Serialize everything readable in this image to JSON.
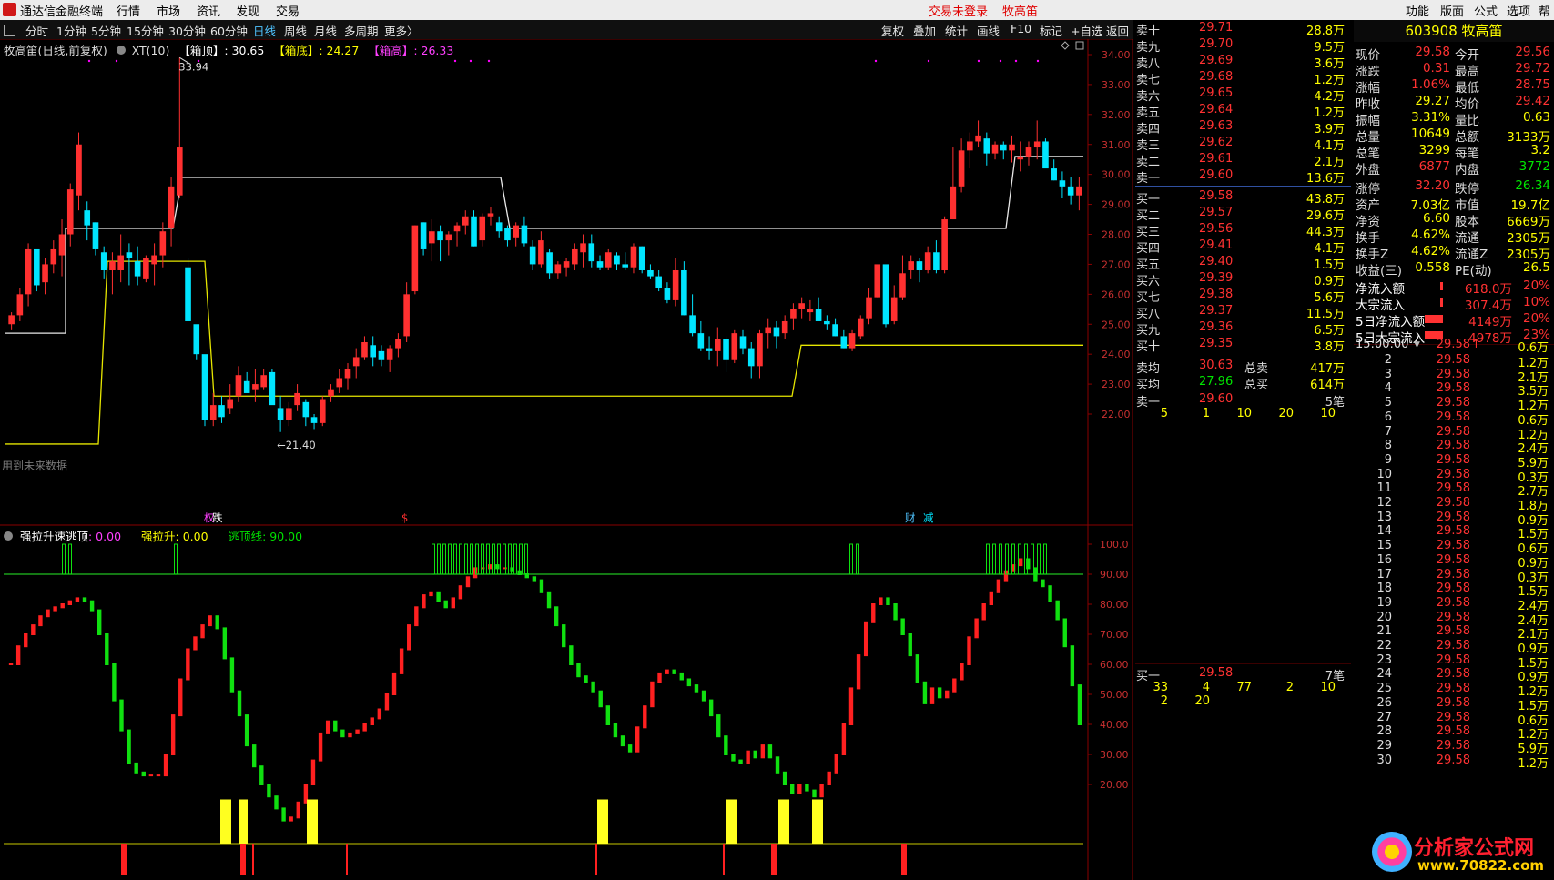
{
  "app": {
    "title": "通达信金融终端",
    "menus": [
      "行情",
      "市场",
      "资讯",
      "发现",
      "交易"
    ],
    "login": "交易未登录",
    "stock_name": "牧高笛",
    "right_menus": [
      "功能",
      "版面",
      "公式",
      "选项",
      "帮助"
    ]
  },
  "toolbar": {
    "periods": [
      "分时",
      "1分钟",
      "5分钟",
      "15分钟",
      "30分钟",
      "60分钟",
      "日线",
      "周线",
      "月线",
      "多周期",
      "更多〉"
    ],
    "active_period": "日线",
    "buttons": [
      "复权",
      "叠加",
      "统计",
      "画线",
      "F10",
      "标记",
      "+自选",
      "返回"
    ]
  },
  "main": {
    "title": "牧高笛(日线,前复权)",
    "indicator": "XT(10)",
    "line1_label": "【箱顶】",
    "line1_value": ": 30.65",
    "line2_label": "【箱底】",
    "line2_value": ": 24.27",
    "line3_label": "【箱高】",
    "line3_value": ": 26.33",
    "y_labels": [
      "34.00",
      "33.00",
      "32.00",
      "31.00",
      "30.00",
      "29.00",
      "28.00",
      "27.00",
      "26.00",
      "25.00",
      "24.00",
      "23.00",
      "22.00"
    ],
    "high_label": "33.94",
    "low_label": "←21.40",
    "footer_note": "用到未来数据",
    "event_labels": [
      "权",
      "跌",
      "$",
      "财",
      "减"
    ]
  },
  "sub": {
    "title": "强拉升速逃顶",
    "v1_label": "强拉升速逃顶",
    "v1": ": 0.00",
    "v2_label": "强拉升",
    "v2": ": 0.00",
    "v3_label": "逃顶线",
    "v3": ": 90.00",
    "y_labels": [
      "100.0",
      "90.00",
      "80.00",
      "70.00",
      "60.00",
      "50.00",
      "40.00",
      "30.00",
      "20.00"
    ]
  },
  "orderbook": {
    "asks": [
      {
        "label": "卖十",
        "price": "29.71",
        "vol": "28.8万",
        "mark": "¥"
      },
      {
        "label": "卖九",
        "price": "29.70",
        "vol": "9.5万"
      },
      {
        "label": "卖八",
        "price": "29.69",
        "vol": "3.6万"
      },
      {
        "label": "卖七",
        "price": "29.68",
        "vol": "1.2万"
      },
      {
        "label": "卖六",
        "price": "29.65",
        "vol": "4.2万"
      },
      {
        "label": "卖五",
        "price": "29.64",
        "vol": "1.2万"
      },
      {
        "label": "卖四",
        "price": "29.63",
        "vol": "3.9万"
      },
      {
        "label": "卖三",
        "price": "29.62",
        "vol": "4.1万"
      },
      {
        "label": "卖二",
        "price": "29.61",
        "vol": "2.1万"
      },
      {
        "label": "卖一",
        "price": "29.60",
        "vol": "13.6万"
      }
    ],
    "bids": [
      {
        "label": "买一",
        "price": "29.58",
        "vol": "43.8万"
      },
      {
        "label": "买二",
        "price": "29.57",
        "vol": "29.6万"
      },
      {
        "label": "买三",
        "price": "29.56",
        "vol": "44.3万"
      },
      {
        "label": "买四",
        "price": "29.41",
        "vol": "4.1万"
      },
      {
        "label": "买五",
        "price": "29.40",
        "vol": "1.5万"
      },
      {
        "label": "买六",
        "price": "29.39",
        "vol": "0.9万"
      },
      {
        "label": "买七",
        "price": "29.38",
        "vol": "5.6万"
      },
      {
        "label": "买八",
        "price": "29.37",
        "vol": "11.5万"
      },
      {
        "label": "买九",
        "price": "29.36",
        "vol": "6.5万"
      },
      {
        "label": "买十",
        "price": "29.35",
        "vol": "3.8万",
        "mark": "$"
      }
    ],
    "avg_sell_label": "卖均",
    "avg_sell": "30.63",
    "total_sell_label": "总卖",
    "total_sell": "417万",
    "avg_buy_label": "买均",
    "avg_buy": "27.96",
    "total_buy_label": "总买",
    "total_buy": "614万",
    "sell1_label": "卖一",
    "sell1_price": "29.60",
    "sell1_count": "5笔",
    "sell1_queue": [
      "5",
      "1",
      "10",
      "20",
      "10"
    ],
    "buy1_label": "买一",
    "buy1_price": "29.58",
    "buy1_count": "7笔",
    "buy1_queue": [
      "33",
      "4",
      "77",
      "2",
      "10",
      "2",
      "20"
    ]
  },
  "info": {
    "code_name": "603908 牧高笛",
    "rows": [
      [
        "现价",
        "29.58",
        "今开",
        "29.56"
      ],
      [
        "涨跌",
        "0.31",
        "最高",
        "29.72"
      ],
      [
        "涨幅",
        "1.06%",
        "最低",
        "28.75"
      ],
      [
        "昨收",
        "29.27",
        "均价",
        "29.42"
      ],
      [
        "振幅",
        "3.31%",
        "量比",
        "0.63"
      ],
      [
        "总量",
        "10649",
        "总额",
        "3133万"
      ],
      [
        "总笔",
        "3299",
        "每笔",
        "3.2"
      ],
      [
        "外盘",
        "6877",
        "内盘",
        "3772"
      ],
      [
        "涨停",
        "32.20",
        "跌停",
        "26.34"
      ],
      [
        "资产",
        "7.03亿",
        "市值",
        "19.7亿"
      ],
      [
        "净资",
        "6.60",
        "股本",
        "6669万"
      ],
      [
        "换手",
        "4.62%",
        "流通",
        "2305万"
      ],
      [
        "换手Z",
        "4.62%",
        "流通Z",
        "2305万"
      ],
      [
        "收益(三)",
        "0.558",
        "PE(动)",
        "26.5"
      ]
    ],
    "flows": [
      [
        "净流入额",
        "618.0万",
        "20%"
      ],
      [
        "大宗流入",
        "307.4万",
        "10%"
      ],
      [
        "5日净流入额",
        "4149万",
        "20%"
      ],
      [
        "5日大宗流入",
        "4978万",
        "23%"
      ]
    ],
    "tick_time": "15:00:00",
    "tick_price": "29.58",
    "tick_vol": "0.6万",
    "ticks": [
      [
        "2",
        "29.58",
        "1.2万"
      ],
      [
        "3",
        "29.58",
        "2.1万"
      ],
      [
        "4",
        "29.58",
        "3.5万"
      ],
      [
        "5",
        "29.58",
        "1.2万"
      ],
      [
        "6",
        "29.58",
        "0.6万"
      ],
      [
        "7",
        "29.58",
        "1.2万"
      ],
      [
        "8",
        "29.58",
        "2.4万"
      ],
      [
        "9",
        "29.58",
        "5.9万"
      ],
      [
        "10",
        "29.58",
        "0.3万"
      ],
      [
        "11",
        "29.58",
        "2.7万"
      ],
      [
        "12",
        "29.58",
        "1.8万"
      ],
      [
        "13",
        "29.58",
        "0.9万"
      ],
      [
        "14",
        "29.58",
        "1.5万"
      ],
      [
        "15",
        "29.58",
        "0.6万"
      ],
      [
        "16",
        "29.58",
        "0.9万"
      ],
      [
        "17",
        "29.58",
        "0.3万"
      ],
      [
        "18",
        "29.58",
        "1.5万"
      ],
      [
        "19",
        "29.58",
        "2.4万"
      ],
      [
        "20",
        "29.58",
        "2.4万"
      ],
      [
        "21",
        "29.58",
        "2.1万"
      ],
      [
        "22",
        "29.58",
        "0.9万"
      ],
      [
        "23",
        "29.58",
        "1.5万"
      ],
      [
        "24",
        "29.58",
        "0.9万"
      ],
      [
        "25",
        "29.58",
        "1.2万"
      ],
      [
        "26",
        "29.58",
        "1.5万"
      ],
      [
        "27",
        "29.58",
        "0.6万"
      ],
      [
        "28",
        "29.58",
        "1.2万"
      ],
      [
        "29",
        "29.58",
        "5.9万"
      ],
      [
        "30",
        "29.58",
        "1.2万"
      ]
    ],
    "watermark": "分析家公式网",
    "watermark_url": "www.70822.com"
  },
  "chart_data": {
    "type": "candlestick",
    "candles": [
      [
        25,
        25.4,
        24.8,
        25.3
      ],
      [
        25.3,
        26.2,
        25.1,
        26
      ],
      [
        26,
        27.7,
        25.6,
        27.5
      ],
      [
        27.5,
        27.4,
        26.1,
        26.3
      ],
      [
        26.4,
        27.2,
        26,
        27
      ],
      [
        27,
        27.8,
        26.7,
        27.5
      ],
      [
        27.3,
        28.5,
        26.6,
        28
      ],
      [
        28,
        29.7,
        27.6,
        29.5
      ],
      [
        29.3,
        31.4,
        28.8,
        31
      ],
      [
        28.8,
        29.1,
        27.8,
        28.3
      ],
      [
        28.4,
        28.4,
        27.3,
        27.5
      ],
      [
        27.4,
        27.6,
        26.5,
        26.8
      ],
      [
        26.8,
        27.4,
        26,
        27.1
      ],
      [
        26.8,
        28,
        26.4,
        27.3
      ],
      [
        27.4,
        27.7,
        26.3,
        27.2
      ],
      [
        27.1,
        27.6,
        26.3,
        26.6
      ],
      [
        26.5,
        27.3,
        26.4,
        27.2
      ],
      [
        27,
        27.7,
        26.3,
        27.3
      ],
      [
        27.3,
        28.4,
        26.9,
        28.1
      ],
      [
        28.2,
        29.9,
        27.6,
        29.6
      ],
      [
        29.3,
        33.9,
        29.2,
        30.9
      ],
      [
        26.9,
        27.2,
        25.6,
        25.1
      ],
      [
        25,
        24.9,
        23.8,
        24
      ],
      [
        24,
        23.5,
        21.6,
        21.8
      ],
      [
        21.8,
        22.7,
        21.6,
        22.3
      ],
      [
        22.3,
        22.6,
        21.7,
        21.9
      ],
      [
        22.2,
        23,
        22,
        22.5
      ],
      [
        22.6,
        23.6,
        22.4,
        23.3
      ],
      [
        23.1,
        23.4,
        22.8,
        22.7
      ],
      [
        22.8,
        23.5,
        22.4,
        23
      ],
      [
        22.9,
        23.5,
        22.8,
        23.3
      ],
      [
        23.4,
        23.5,
        22.4,
        22.3
      ],
      [
        22.2,
        22.6,
        21.4,
        21.8
      ],
      [
        21.8,
        22.4,
        21.6,
        22.2
      ],
      [
        22.3,
        23,
        22.1,
        22.7
      ],
      [
        22.4,
        22.5,
        21.6,
        21.9
      ],
      [
        21.9,
        22,
        21.5,
        21.7
      ],
      [
        21.7,
        22.6,
        21.6,
        22.5
      ],
      [
        22.6,
        23,
        22.4,
        22.8
      ],
      [
        22.9,
        23.5,
        22.7,
        23.2
      ],
      [
        23.2,
        23.7,
        22.8,
        23.5
      ],
      [
        23.6,
        24.2,
        23.2,
        23.9
      ],
      [
        23.9,
        24.6,
        23.8,
        24.4
      ],
      [
        24.3,
        24.6,
        23.6,
        23.9
      ],
      [
        24.1,
        24.3,
        23.6,
        23.8
      ],
      [
        23.8,
        24.3,
        23.4,
        24.2
      ],
      [
        24.2,
        24.7,
        23.9,
        24.5
      ],
      [
        24.6,
        26.4,
        24.4,
        26
      ],
      [
        26.1,
        28.3,
        26,
        28.3
      ],
      [
        28.4,
        28.4,
        27.3,
        27.5
      ],
      [
        27.7,
        28.5,
        27.1,
        28.1
      ],
      [
        28.1,
        28.3,
        27.1,
        27.8
      ],
      [
        27.8,
        28.1,
        27.3,
        28
      ],
      [
        28.1,
        28.4,
        27.6,
        28.3
      ],
      [
        28.3,
        28.8,
        28,
        28.6
      ],
      [
        28.6,
        28.8,
        27.6,
        27.6
      ],
      [
        27.8,
        28.7,
        27.6,
        28.6
      ],
      [
        28.6,
        28.9,
        28.3,
        28.7
      ],
      [
        28.4,
        28.6,
        27.9,
        28.1
      ],
      [
        28.2,
        28.3,
        27.6,
        27.8
      ],
      [
        27.9,
        28.4,
        27.6,
        28.3
      ],
      [
        28.3,
        28.6,
        27.6,
        27.7
      ],
      [
        27.6,
        27.8,
        26.8,
        27
      ],
      [
        27,
        28.1,
        26.9,
        27.8
      ],
      [
        27.4,
        27.5,
        26.5,
        26.7
      ],
      [
        26.7,
        27.1,
        26.5,
        27
      ],
      [
        26.9,
        27.2,
        26.6,
        27.1
      ],
      [
        27,
        27.7,
        26.8,
        27.5
      ],
      [
        27.4,
        28,
        26.9,
        27.7
      ],
      [
        27.7,
        28,
        26.9,
        27.1
      ],
      [
        27.1,
        27.3,
        26.8,
        26.9
      ],
      [
        26.9,
        27.5,
        26.8,
        27.4
      ],
      [
        27.3,
        27.4,
        26.8,
        27
      ],
      [
        27,
        27.4,
        26.8,
        26.9
      ],
      [
        26.9,
        27.7,
        26.7,
        27.6
      ],
      [
        27.6,
        27.6,
        26.7,
        26.8
      ],
      [
        26.8,
        27,
        26.5,
        26.6
      ],
      [
        26.6,
        26.8,
        26.1,
        26.2
      ],
      [
        26.2,
        26.4,
        25.7,
        25.8
      ],
      [
        25.8,
        27.2,
        25.6,
        26.8
      ],
      [
        26.8,
        27.1,
        25.3,
        25.3
      ],
      [
        25.3,
        26,
        24.6,
        24.7
      ],
      [
        24.7,
        25.1,
        24.1,
        24.2
      ],
      [
        24.2,
        24.6,
        23.8,
        24.1
      ],
      [
        24.1,
        24.9,
        23.6,
        24.5
      ],
      [
        24.5,
        24.6,
        23.4,
        23.8
      ],
      [
        23.8,
        24.8,
        23.7,
        24.7
      ],
      [
        24.6,
        24.8,
        24,
        24.2
      ],
      [
        24.2,
        24.4,
        23.2,
        23.6
      ],
      [
        23.6,
        24.8,
        23.2,
        24.7
      ],
      [
        24.7,
        25.2,
        24.2,
        24.9
      ],
      [
        24.9,
        25.1,
        24.2,
        24.6
      ],
      [
        24.7,
        25.3,
        24.5,
        25.1
      ],
      [
        25.2,
        25.7,
        24.8,
        25.5
      ],
      [
        25.5,
        25.9,
        25.2,
        25.7
      ],
      [
        25.4,
        25.8,
        25.1,
        25.5
      ],
      [
        25.5,
        25.9,
        25.4,
        25.1
      ],
      [
        25.1,
        25.3,
        24.8,
        25
      ],
      [
        25,
        25.2,
        24.6,
        24.6
      ],
      [
        24.6,
        24.8,
        24.2,
        24.2
      ],
      [
        24.2,
        24.8,
        24.1,
        24.7
      ],
      [
        24.6,
        25.3,
        24.5,
        25.2
      ],
      [
        25.2,
        26.2,
        25,
        25.9
      ],
      [
        25.9,
        26.4,
        25.9,
        27
      ],
      [
        27,
        26.1,
        24.9,
        25
      ],
      [
        25.1,
        26.3,
        25,
        25.9
      ],
      [
        25.9,
        27.3,
        25.8,
        26.7
      ],
      [
        26.8,
        27.3,
        26.5,
        27.1
      ],
      [
        27.1,
        27.2,
        26.4,
        26.8
      ],
      [
        26.8,
        27.6,
        26.7,
        27.4
      ],
      [
        27.4,
        27.8,
        26.7,
        26.8
      ],
      [
        26.8,
        28.6,
        26.7,
        28.5
      ],
      [
        28.5,
        30.9,
        28.5,
        29.6
      ],
      [
        29.6,
        31.2,
        29.4,
        30.8
      ],
      [
        30.8,
        31.4,
        30.2,
        31.1
      ],
      [
        31.1,
        31.8,
        30.9,
        31.3
      ],
      [
        31.2,
        31.4,
        30.3,
        30.7
      ],
      [
        30.7,
        31.1,
        30.5,
        31
      ],
      [
        31,
        31.1,
        30.5,
        30.8
      ],
      [
        30.8,
        31.3,
        30.4,
        31
      ],
      [
        30.5,
        31.1,
        30.1,
        30.6
      ],
      [
        30.6,
        31.1,
        30.3,
        30.9
      ],
      [
        30.9,
        31.8,
        30.5,
        31.1
      ],
      [
        31.1,
        31.2,
        30.3,
        30.2
      ],
      [
        30.2,
        30.5,
        29.8,
        29.8
      ],
      [
        29.8,
        30.1,
        29.2,
        29.6
      ],
      [
        29.6,
        29.9,
        29,
        29.3
      ],
      [
        29.3,
        29.9,
        28.8,
        29.6
      ]
    ],
    "box_top_line": [
      27.8,
      27.8,
      27.8,
      27.8,
      30.6,
      30.6,
      28.2,
      28.2,
      28.2,
      28.2
    ],
    "escape_line": 90,
    "title": "牧高笛(日线,前复权)"
  }
}
